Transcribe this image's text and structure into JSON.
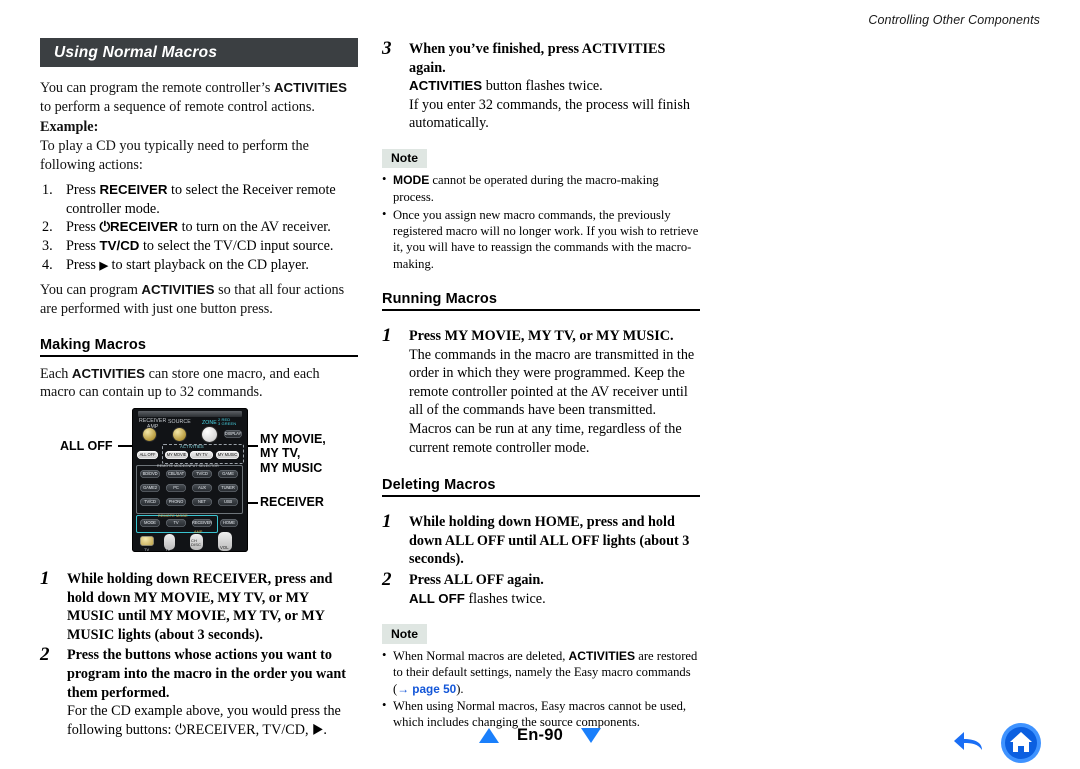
{
  "header": {
    "running_title": "Controlling Other Components"
  },
  "left_column": {
    "title_bar": "Using Normal Macros",
    "intro": "You can program the remote controller’s ACTIVITIES to perform a sequence of remote control actions.",
    "intro_bold_term": "ACTIVITIES",
    "example_label": "Example:",
    "example_intro": "To play a CD you typically need to perform the following actions:",
    "example_steps": [
      {
        "marker": "1.",
        "pre": "Press ",
        "bold": "RECEIVER",
        "post": " to select the Receiver remote controller mode."
      },
      {
        "marker": "2.",
        "pre": "Press ",
        "bold": "⏻RECEIVER",
        "post": " to turn on the AV receiver."
      },
      {
        "marker": "3.",
        "pre": "Press ",
        "bold": "TV/CD",
        "post": " to select the TV/CD input source."
      },
      {
        "marker": "4.",
        "pre": "Press ",
        "bold": "▶",
        "post": " to start playback on the CD player."
      }
    ],
    "example_outro_a": "You can program ",
    "example_outro_bold": "ACTIVITIES",
    "example_outro_b": " so that all four actions are performed with just one button press.",
    "making_macros": {
      "heading": "Making Macros",
      "body_a": "Each ",
      "body_bold": "ACTIVITIES",
      "body_b": " can store one macro, and each macro can contain up to 32 commands."
    },
    "steps": [
      {
        "num": "1",
        "lead": "While holding down RECEIVER, press and hold down MY MOVIE, MY TV, or MY MUSIC until MY MOVIE, MY TV, or MY MUSIC lights (about 3 seconds).",
        "body": ""
      },
      {
        "num": "2",
        "lead": "Press the buttons whose actions you want to program into the macro in the order you want them performed.",
        "body": "For the CD example above, you would press the following buttons: ⏻RECEIVER, TV/CD, ▶."
      }
    ]
  },
  "remote_figure": {
    "name": "remote-controller-diagram",
    "callouts": {
      "all_off": "ALL OFF",
      "my_buttons": "MY MOVIE,\nMY TV,\nMY MUSIC",
      "receiver": "RECEIVER"
    },
    "top_labels": {
      "receiver_amp": "RECEIVER\nAMP",
      "source": "SOURCE",
      "zone": "ZONE",
      "zone_sub": "2 RED\n3 GREEN",
      "display": "DISPLAY"
    },
    "group_labels": {
      "activities": "ACTIVITIES",
      "remote_mode_input": "REMOTE MODE/INPUT SELECTOR",
      "remote_mode": "REMOTE MODE",
      "amp": "AMP"
    },
    "buttons": {
      "all_off": "ALL OFF",
      "my_movie": "MY MOVIE",
      "my_tv": "MY TV",
      "my_music": "MY MUSIC",
      "row1": [
        "BD/DVD",
        "CBL/SAT",
        "TV/CD",
        "GAME"
      ],
      "row2": [
        "GAME2",
        "PC",
        "AUX",
        "TUNER"
      ],
      "row3": [
        "TV/CD",
        "PHONO",
        "NET",
        "USB"
      ],
      "row4": [
        "MODE",
        "TV",
        "RECEIVER",
        "HOME"
      ],
      "bottom": [
        "TV",
        "CH",
        "DISC",
        "VOL"
      ]
    }
  },
  "right_column": {
    "step3": {
      "num": "3",
      "lead": "When you’ve finished, press ACTIVITIES again.",
      "line2_bold": "ACTIVITIES",
      "line2_rest": " button flashes twice.",
      "body": "If you enter 32 commands, the process will finish automatically."
    },
    "note1": {
      "label": "Note",
      "items": [
        {
          "bold": "MODE",
          "rest": " cannot be operated during the macro-making process."
        },
        {
          "bold": "",
          "rest": "Once you assign new macro commands, the previously registered macro will no longer work. If you wish to retrieve it, you will have to reassign the commands with the macro-making."
        }
      ]
    },
    "running_macros": {
      "heading": "Running Macros",
      "step": {
        "num": "1",
        "lead": "Press MY MOVIE, MY TV, or MY MUSIC.",
        "body1": "The commands in the macro are transmitted in the order in which they were programmed. Keep the remote controller pointed at the AV receiver until all of the commands have been transmitted.",
        "body2": "Macros can be run at any time, regardless of the current remote controller mode."
      }
    },
    "deleting_macros": {
      "heading": "Deleting Macros",
      "steps": [
        {
          "num": "1",
          "lead": "While holding down HOME, press and hold down ALL OFF until ALL OFF lights (about 3 seconds).",
          "body": ""
        },
        {
          "num": "2",
          "lead": "Press ALL OFF again.",
          "body_bold": "ALL OFF",
          "body_rest": " flashes twice."
        }
      ]
    },
    "note2": {
      "label": "Note",
      "item1_a": "When Normal macros are deleted, ",
      "item1_bold": "ACTIVITIES",
      "item1_b": " are restored to their default settings, namely the Easy macro commands (",
      "item1_link": "→ page 50",
      "item1_c": ").",
      "item2": "When using Normal macros, Easy macros cannot be used, which includes changing the source components."
    }
  },
  "footer": {
    "page_label": "En-90",
    "prev_icon": "triangle-up-icon",
    "next_icon": "triangle-down-icon",
    "back_icon": "back-arrow-icon",
    "home_icon": "home-icon",
    "accent_color": "#1a7ffb"
  }
}
